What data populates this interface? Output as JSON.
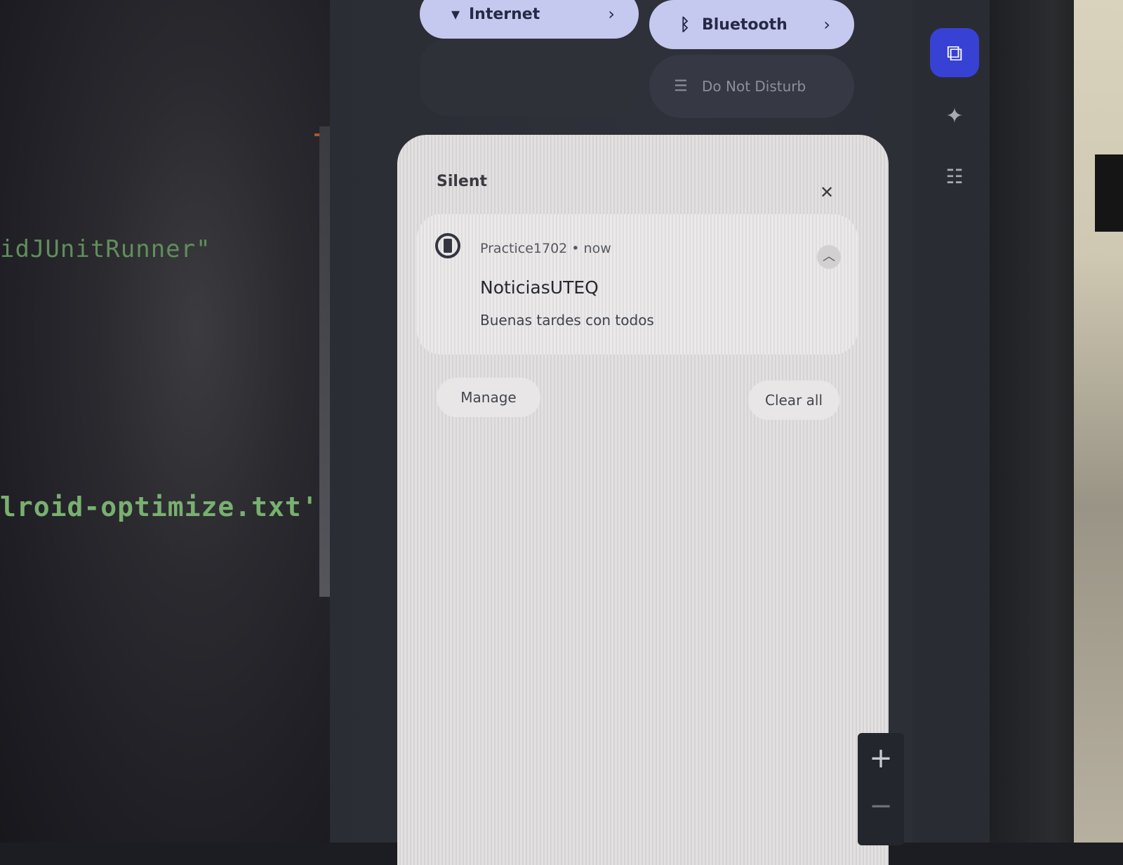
{
  "editor": {
    "line_1": "idJUnitRunner\"",
    "line_2": "lroid-optimize.txt'),"
  },
  "quick_settings": {
    "internet_label": "Internet",
    "bluetooth_label": "Bluetooth",
    "dnd_label": "Do Not Disturb",
    "chevron": "›"
  },
  "notifications": {
    "section_title": "Silent",
    "close_symbol": "✕",
    "card": {
      "app": "Practice1702",
      "time": "now",
      "meta": "Practice1702 • now",
      "title": "NoticiasUTEQ",
      "body": "Buenas tardes con todos",
      "expand_symbol": "︿"
    },
    "manage_label": "Manage",
    "clear_all_label": "Clear all"
  },
  "toolbar": {
    "zoom_in": "+",
    "zoom_out": "−"
  },
  "colors": {
    "tile_active": "#c5c8ef",
    "rail_active": "#3742d4",
    "code_green": "#79b070"
  },
  "icons": [
    "wifi-icon",
    "bluetooth-icon",
    "dnd-icon",
    "close-icon",
    "app-icon",
    "chevron-up-icon",
    "tote-icon",
    "sparkle-icon",
    "checklist-icon"
  ]
}
